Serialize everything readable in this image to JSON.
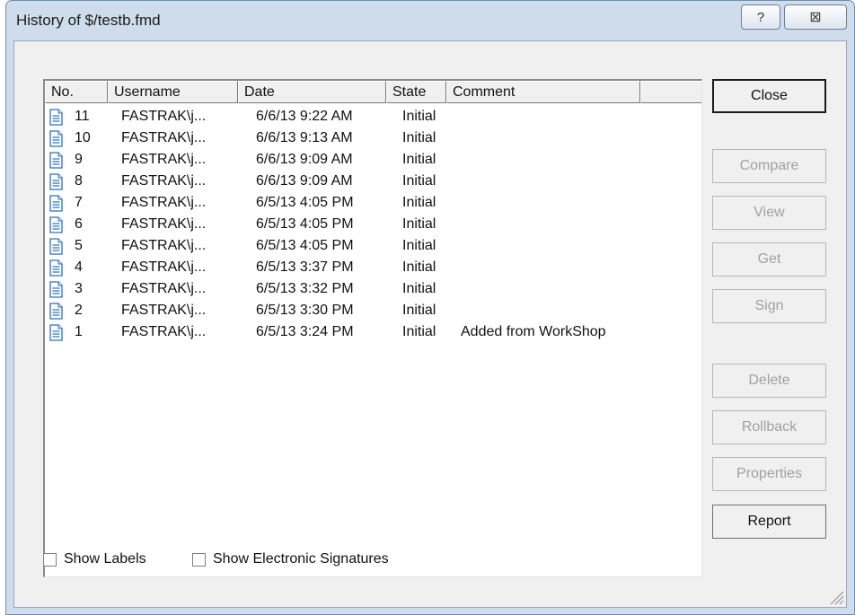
{
  "window": {
    "title": "History of $/testb.fmd",
    "help_glyph": "?",
    "close_glyph": "⊠"
  },
  "list": {
    "columns": [
      "No.",
      "Username",
      "Date",
      "State",
      "Comment"
    ],
    "rows": [
      {
        "no": "11",
        "user": "FASTRAK\\j...",
        "date": "6/6/13 9:22 AM",
        "state": "Initial",
        "comment": ""
      },
      {
        "no": "10",
        "user": "FASTRAK\\j...",
        "date": "6/6/13 9:13 AM",
        "state": "Initial",
        "comment": ""
      },
      {
        "no": "9",
        "user": "FASTRAK\\j...",
        "date": "6/6/13 9:09 AM",
        "state": "Initial",
        "comment": ""
      },
      {
        "no": "8",
        "user": "FASTRAK\\j...",
        "date": "6/6/13 9:09 AM",
        "state": "Initial",
        "comment": ""
      },
      {
        "no": "7",
        "user": "FASTRAK\\j...",
        "date": "6/5/13 4:05 PM",
        "state": "Initial",
        "comment": ""
      },
      {
        "no": "6",
        "user": "FASTRAK\\j...",
        "date": "6/5/13 4:05 PM",
        "state": "Initial",
        "comment": ""
      },
      {
        "no": "5",
        "user": "FASTRAK\\j...",
        "date": "6/5/13 4:05 PM",
        "state": "Initial",
        "comment": ""
      },
      {
        "no": "4",
        "user": "FASTRAK\\j...",
        "date": "6/5/13 3:37 PM",
        "state": "Initial",
        "comment": ""
      },
      {
        "no": "3",
        "user": "FASTRAK\\j...",
        "date": "6/5/13 3:32 PM",
        "state": "Initial",
        "comment": ""
      },
      {
        "no": "2",
        "user": "FASTRAK\\j...",
        "date": "6/5/13 3:30 PM",
        "state": "Initial",
        "comment": ""
      },
      {
        "no": "1",
        "user": "FASTRAK\\j...",
        "date": "6/5/13 3:24 PM",
        "state": "Initial",
        "comment": "Added from WorkShop"
      }
    ]
  },
  "buttons": {
    "close": "Close",
    "compare": "Compare",
    "view": "View",
    "get": "Get",
    "sign": "Sign",
    "delete": "Delete",
    "rollback": "Rollback",
    "properties": "Properties",
    "report": "Report"
  },
  "options": {
    "show_labels": "Show Labels",
    "show_signatures": "Show Electronic Signatures"
  },
  "colors": {
    "title_frame": "#cfdcec",
    "client_bg": "#f0f0f0",
    "disabled_text": "#a0a0a0",
    "doc_icon_blue": "#2f6fb5"
  }
}
